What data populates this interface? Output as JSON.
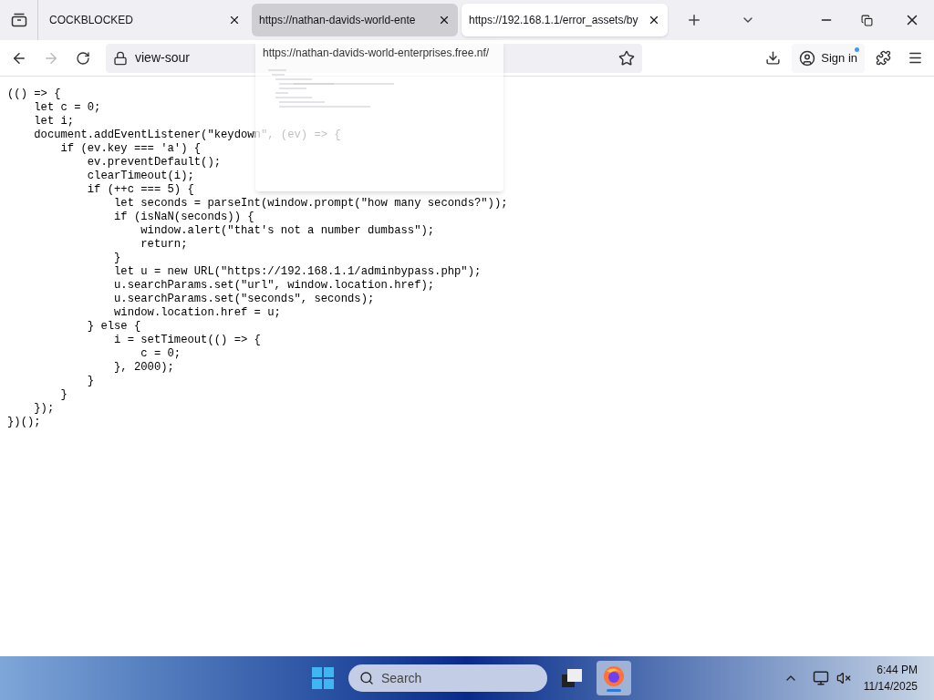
{
  "tabs": [
    {
      "label": "COCKBLOCKED",
      "selected": false,
      "hovered": false
    },
    {
      "label": "https://nathan-davids-world-ente",
      "selected": false,
      "hovered": true
    },
    {
      "label": "https://192.168.1.1/error_assets/by",
      "selected": true,
      "hovered": false
    }
  ],
  "tab_preview": {
    "title": "https://nathan-davids-world-enterprises.free.nf/"
  },
  "address_bar": {
    "value": "view-sour"
  },
  "account": {
    "label": "Sign in"
  },
  "code_lines": [
    "(() => {",
    "    let c = 0;",
    "    let i;",
    "    document.addEventListener(\"keydown\", (ev) => {",
    "        if (ev.key === 'a') {",
    "            ev.preventDefault();",
    "            clearTimeout(i);",
    "            if (++c === 5) {",
    "                let seconds = parseInt(window.prompt(\"how many seconds?\"));",
    "                if (isNaN(seconds)) {",
    "                    window.alert(\"that's not a number dumbass\");",
    "                    return;",
    "                }",
    "                let u = new URL(\"https://192.168.1.1/adminbypass.php\");",
    "                u.searchParams.set(\"url\", window.location.href);",
    "                u.searchParams.set(\"seconds\", seconds);",
    "                window.location.href = u;",
    "            } else {",
    "                i = setTimeout(() => {",
    "                    c = 0;",
    "                }, 2000);",
    "            }",
    "        }",
    "    });",
    "})();"
  ],
  "taskbar": {
    "search_placeholder": "Search",
    "firefox_active": true,
    "time": "6:44 PM",
    "date": "11/14/2025"
  }
}
